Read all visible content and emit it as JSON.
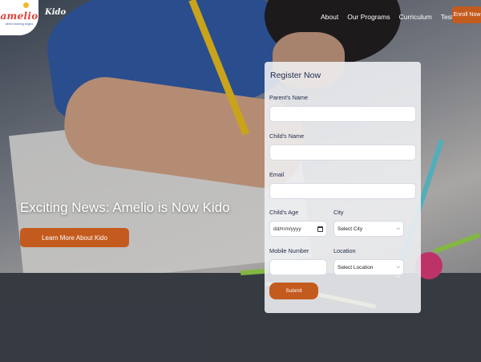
{
  "brand": {
    "logo_text": "amelio",
    "logo_tagline": "where learning begins",
    "secondary_name": "Kido"
  },
  "nav": {
    "items": [
      {
        "label": "About"
      },
      {
        "label": "Our Programs"
      },
      {
        "label": "Curriculum"
      },
      {
        "label": "Testimonial"
      }
    ],
    "enroll_label": "Enroll Now"
  },
  "hero": {
    "headline": "Exciting News: Amelio is Now Kido",
    "cta_label": "Learn More About Kido"
  },
  "form": {
    "title": "Register Now",
    "parent_name_label": "Parent's Name",
    "parent_name_value": "",
    "child_name_label": "Child's Name",
    "child_name_value": "",
    "email_label": "Email",
    "email_value": "",
    "child_age_label": "Child's Age",
    "child_age_placeholder": "dd/mm/yyyy",
    "city_label": "City",
    "city_selected": "Select City",
    "mobile_label": "Mobile Number",
    "mobile_value": "",
    "location_label": "Location",
    "location_selected": "Select Location",
    "submit_label": "Submit"
  },
  "colors": {
    "accent": "#c45b1e",
    "form_title": "#1f2a4a",
    "logo_red": "#e0413a"
  }
}
